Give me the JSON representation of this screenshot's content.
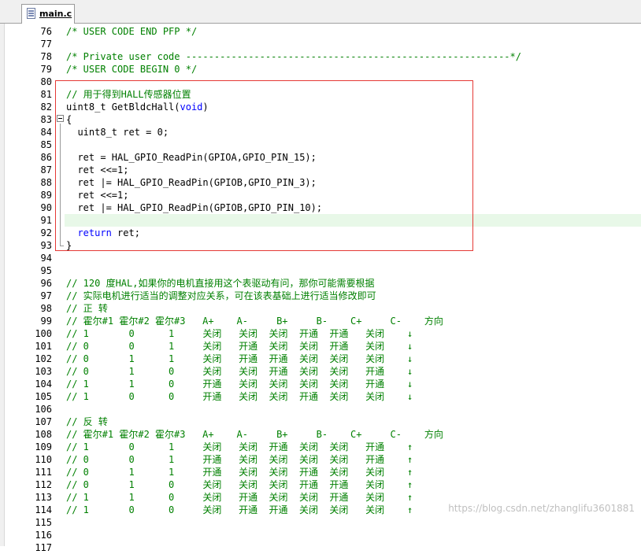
{
  "tab": {
    "label": "main.c"
  },
  "watermark": "https://blog.csdn.net/zhanglifu3601881",
  "colors": {
    "comment": "#008000",
    "keyword": "#0000ff",
    "highlight_box": "#e53935",
    "current_line": "#e8f8e8"
  },
  "lines": [
    {
      "n": "76",
      "segs": [
        {
          "t": "/* USER CODE END PFP */",
          "c": "cm"
        }
      ]
    },
    {
      "n": "77",
      "segs": []
    },
    {
      "n": "78",
      "segs": [
        {
          "t": "/* Private user code ---------------------------------------------------------*/",
          "c": "cm"
        }
      ]
    },
    {
      "n": "79",
      "segs": [
        {
          "t": "/* USER CODE BEGIN 0 */",
          "c": "cm"
        }
      ]
    },
    {
      "n": "80",
      "segs": []
    },
    {
      "n": "81",
      "segs": [
        {
          "t": "// 用于得到HALL传感器位置",
          "c": "cm"
        }
      ]
    },
    {
      "n": "82",
      "segs": [
        {
          "t": "uint8_t GetBldcHall(",
          "c": ""
        },
        {
          "t": "void",
          "c": "kw"
        },
        {
          "t": ")",
          "c": ""
        }
      ]
    },
    {
      "n": "83",
      "segs": [
        {
          "t": "{",
          "c": ""
        }
      ]
    },
    {
      "n": "84",
      "segs": [
        {
          "t": "  uint8_t ret = 0;",
          "c": ""
        }
      ]
    },
    {
      "n": "85",
      "segs": []
    },
    {
      "n": "86",
      "segs": [
        {
          "t": "  ret = HAL_GPIO_ReadPin(GPIOA,GPIO_PIN_15);",
          "c": ""
        }
      ]
    },
    {
      "n": "87",
      "segs": [
        {
          "t": "  ret <<=1;",
          "c": ""
        }
      ]
    },
    {
      "n": "88",
      "segs": [
        {
          "t": "  ret |= HAL_GPIO_ReadPin(GPIOB,GPIO_PIN_3);",
          "c": ""
        }
      ]
    },
    {
      "n": "89",
      "segs": [
        {
          "t": "  ret <<=1;",
          "c": ""
        }
      ]
    },
    {
      "n": "90",
      "segs": [
        {
          "t": "  ret |= HAL_GPIO_ReadPin(GPIOB,GPIO_PIN_10);",
          "c": ""
        }
      ]
    },
    {
      "n": "91",
      "segs": [],
      "current": true
    },
    {
      "n": "92",
      "segs": [
        {
          "t": "  ",
          "c": ""
        },
        {
          "t": "return",
          "c": "kw"
        },
        {
          "t": " ret;",
          "c": ""
        }
      ]
    },
    {
      "n": "93",
      "segs": [
        {
          "t": "}",
          "c": ""
        }
      ]
    },
    {
      "n": "94",
      "segs": []
    },
    {
      "n": "95",
      "segs": []
    },
    {
      "n": "96",
      "segs": [
        {
          "t": "// 120 度HAL,如果你的电机直接用这个表驱动有问，那你可能需要根据",
          "c": "cm"
        }
      ]
    },
    {
      "n": "97",
      "segs": [
        {
          "t": "// 实际电机进行适当的调整对应关系，可在该表基础上进行适当修改即可",
          "c": "cm"
        }
      ]
    },
    {
      "n": "98",
      "segs": [
        {
          "t": "// 正 转",
          "c": "cm"
        }
      ]
    },
    {
      "n": "99",
      "segs": [
        {
          "t": "// 霍尔#1 霍尔#2 霍尔#3   A+    A-     B+     B-    C+     C-    方向",
          "c": "cm"
        }
      ]
    },
    {
      "n": "100",
      "segs": [
        {
          "t": "// 1       0      1     关闭   关闭  关闭  开通  开通   关闭    ↓",
          "c": "cm"
        }
      ]
    },
    {
      "n": "101",
      "segs": [
        {
          "t": "// 0       0      1     关闭   开通  关闭  关闭  开通   关闭    ↓",
          "c": "cm"
        }
      ]
    },
    {
      "n": "102",
      "segs": [
        {
          "t": "// 0       1      1     关闭   开通  开通  关闭  关闭   关闭    ↓",
          "c": "cm"
        }
      ]
    },
    {
      "n": "103",
      "segs": [
        {
          "t": "// 0       1      0     关闭   关闭  开通  关闭  关闭   开通    ↓",
          "c": "cm"
        }
      ]
    },
    {
      "n": "104",
      "segs": [
        {
          "t": "// 1       1      0     开通   关闭  关闭  关闭  关闭   开通    ↓",
          "c": "cm"
        }
      ]
    },
    {
      "n": "105",
      "segs": [
        {
          "t": "// 1       0      0     开通   关闭  关闭  开通  关闭   关闭    ↓",
          "c": "cm"
        }
      ]
    },
    {
      "n": "106",
      "segs": []
    },
    {
      "n": "107",
      "segs": [
        {
          "t": "// 反 转",
          "c": "cm"
        }
      ]
    },
    {
      "n": "108",
      "segs": [
        {
          "t": "// 霍尔#1 霍尔#2 霍尔#3   A+    A-     B+     B-    C+     C-    方向",
          "c": "cm"
        }
      ]
    },
    {
      "n": "109",
      "segs": [
        {
          "t": "// 1       0      1     关闭   关闭  开通  关闭  关闭   开通    ↑",
          "c": "cm"
        }
      ]
    },
    {
      "n": "110",
      "segs": [
        {
          "t": "// 0       0      1     开通   关闭  关闭  关闭  关闭   开通    ↑",
          "c": "cm"
        }
      ]
    },
    {
      "n": "111",
      "segs": [
        {
          "t": "// 0       1      1     开通   关闭  关闭  开通  关闭   关闭    ↑",
          "c": "cm"
        }
      ]
    },
    {
      "n": "112",
      "segs": [
        {
          "t": "// 0       1      0     关闭   关闭  关闭  开通  开通   关闭    ↑",
          "c": "cm"
        }
      ]
    },
    {
      "n": "113",
      "segs": [
        {
          "t": "// 1       1      0     关闭   开通  关闭  关闭  开通   关闭    ↑",
          "c": "cm"
        }
      ]
    },
    {
      "n": "114",
      "segs": [
        {
          "t": "// 1       0      0     关闭   开通  开通  关闭  关闭   关闭    ↑",
          "c": "cm"
        }
      ]
    },
    {
      "n": "115",
      "segs": []
    },
    {
      "n": "116",
      "segs": []
    },
    {
      "n": "117",
      "segs": []
    }
  ]
}
